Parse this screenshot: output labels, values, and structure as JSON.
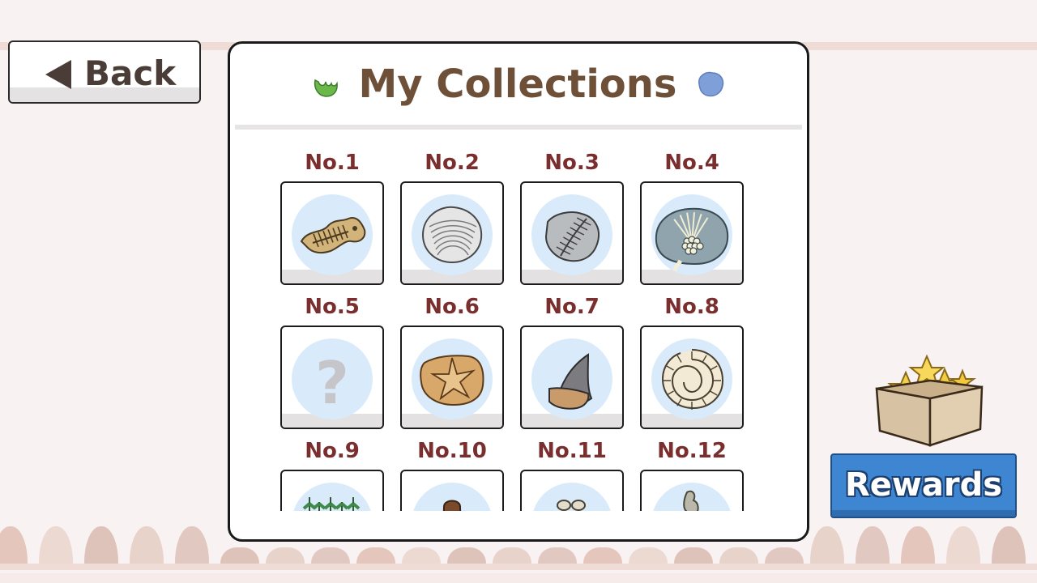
{
  "back_button": {
    "label": "Back"
  },
  "panel": {
    "title": "My Collections"
  },
  "items": [
    {
      "number": "No.1",
      "icon": "fish-fossil-icon"
    },
    {
      "number": "No.2",
      "icon": "shell-fossil-icon"
    },
    {
      "number": "No.3",
      "icon": "leaf-fossil-icon"
    },
    {
      "number": "No.4",
      "icon": "crinoid-fossil-icon"
    },
    {
      "number": "No.5",
      "icon": "unknown-question-icon"
    },
    {
      "number": "No.6",
      "icon": "starfish-fossil-icon"
    },
    {
      "number": "No.7",
      "icon": "shark-tooth-fossil-icon"
    },
    {
      "number": "No.8",
      "icon": "ammonite-fossil-icon"
    },
    {
      "number": "No.9",
      "icon": "plant-fossil-icon"
    },
    {
      "number": "No.10",
      "icon": "brown-fossil-icon"
    },
    {
      "number": "No.11",
      "icon": "bone-fossil-icon"
    },
    {
      "number": "No.12",
      "icon": "bird-fossil-icon"
    }
  ],
  "rewards_button": {
    "label": "Rewards"
  },
  "colors": {
    "background": "#f9f2f2",
    "title": "#6e5038",
    "item_number": "#7a2e2e",
    "rewards": "#3f86d2",
    "icon_circle": "#d9ebfb"
  }
}
